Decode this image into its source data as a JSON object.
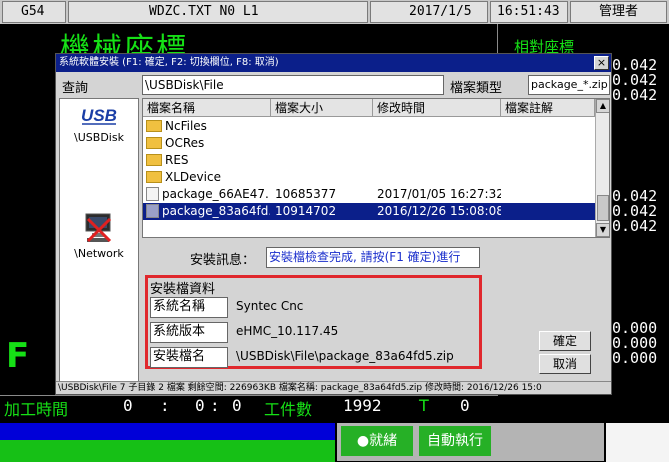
{
  "header": {
    "mode": "G54",
    "program": "WDZC.TXT N0 L1",
    "date": "2017/1/5",
    "time": "16:51:43",
    "user": "管理者"
  },
  "background": {
    "title": "機械座標",
    "relative_title": "相對座標",
    "right_values_top": [
      "0.042",
      "0.042",
      "0.042"
    ],
    "right_values_mid": [
      "0.042",
      "0.042",
      "0.042"
    ],
    "right_values_low": [
      "0.000",
      "0.000",
      "0.000"
    ],
    "feed_letter": "F",
    "work_time_label": "加工時間",
    "work_time": [
      "0",
      ":",
      "0",
      ":",
      "0"
    ],
    "workpiece_label": "工件數",
    "workpiece_count": "1992",
    "t_label": "T",
    "t_value": "0"
  },
  "dialog": {
    "title": "系統軟體安裝 (F1: 確定, F2: 切換欄位, F8: 取消)",
    "close": "×",
    "query_label": "查詢",
    "query_value": "\\USBDisk\\File",
    "type_label": "檔案類型",
    "type_value": "package_*.zip",
    "drives": [
      {
        "label": "\\USBDisk",
        "icon": "usb-drive-icon"
      },
      {
        "label": "\\Network",
        "icon": "network-drive-icon"
      }
    ],
    "usb_text": "USB",
    "columns": [
      "檔案名稱",
      "檔案大小",
      "修改時間",
      "檔案註解"
    ],
    "files": [
      {
        "name": "NcFiles",
        "size": "",
        "time": "",
        "kind": "folder"
      },
      {
        "name": "OCRes",
        "size": "",
        "time": "",
        "kind": "folder"
      },
      {
        "name": "RES",
        "size": "",
        "time": "",
        "kind": "folder"
      },
      {
        "name": "XLDevice",
        "size": "",
        "time": "",
        "kind": "folder"
      },
      {
        "name": "package_66AE47...",
        "size": "10685377",
        "time": "2017/01/05 16:27:32",
        "kind": "file"
      },
      {
        "name": "package_83a64fd...",
        "size": "10914702",
        "time": "2016/12/26 15:08:08",
        "kind": "file"
      }
    ],
    "scroll_up": "▲",
    "scroll_down": "▼",
    "install_msg_label": "安裝訊息：",
    "install_msg": "安裝檔檢查完成, 請按(F1 確定)進行",
    "info_title": "安裝檔資料",
    "info": [
      {
        "label": "系統名稱",
        "value": "Syntec Cnc"
      },
      {
        "label": "系統版本",
        "value": "eHMC_10.117.45"
      },
      {
        "label": "安裝檔名",
        "value": "\\USBDisk\\File\\package_83a64fd5.zip"
      }
    ],
    "ok": "確定",
    "cancel": "取消",
    "status": "\\USBDisk\\File 7 子目錄 2 檔案 剩餘空間: 226963KB     檔案名稱: package_83a64fd5.zip 修改時間: 2016/12/26 15:0"
  },
  "softkeys": {
    "ready": "●就緒",
    "auto": "自動執行"
  }
}
